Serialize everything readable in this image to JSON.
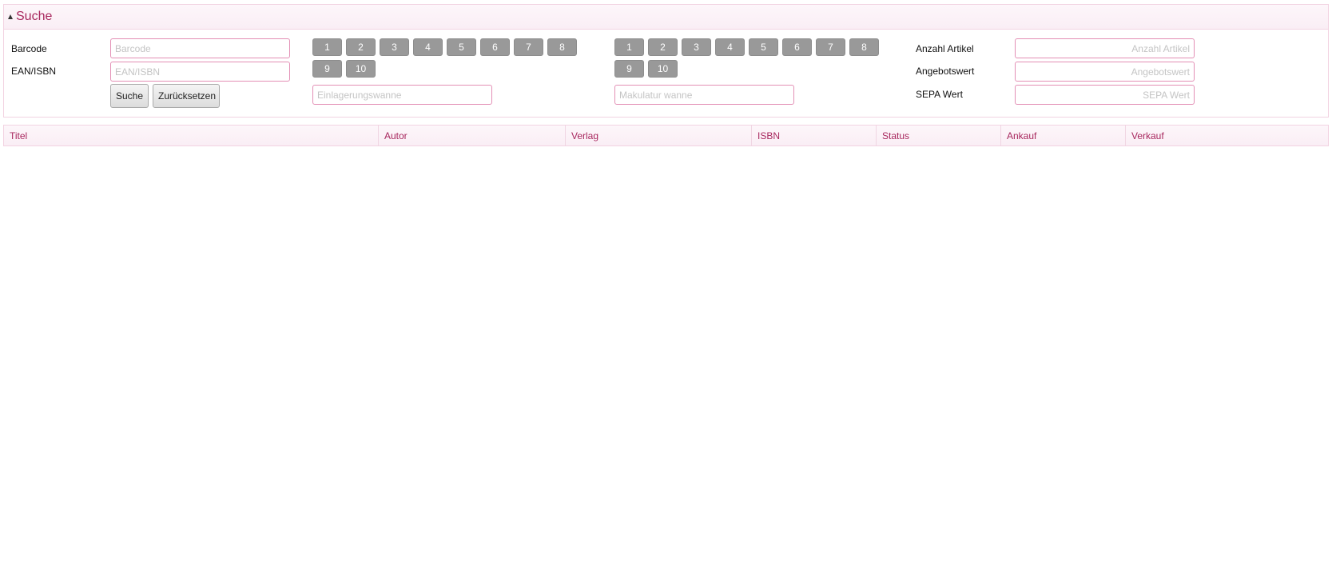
{
  "panel": {
    "title": "Suche"
  },
  "form": {
    "barcode_label": "Barcode",
    "barcode_placeholder": "Barcode",
    "ean_label": "EAN/ISBN",
    "ean_placeholder": "EAN/ISBN",
    "search_button": "Suche",
    "reset_button": "Zurücksetzen",
    "storage_placeholder": "Einlagerungswanne",
    "waste_placeholder": "Makulatur wanne"
  },
  "number_groups": {
    "storage": [
      "1",
      "2",
      "3",
      "4",
      "5",
      "6",
      "7",
      "8",
      "9",
      "10"
    ],
    "waste": [
      "1",
      "2",
      "3",
      "4",
      "5",
      "6",
      "7",
      "8",
      "9",
      "10"
    ]
  },
  "summary": {
    "article_count_label": "Anzahl Artikel",
    "article_count_placeholder": "Anzahl Artikel",
    "offer_value_label": "Angebotswert",
    "offer_value_placeholder": "Angebotswert",
    "sepa_label": "SEPA Wert",
    "sepa_placeholder": "SEPA Wert"
  },
  "table": {
    "columns": [
      "Titel",
      "Autor",
      "Verlag",
      "ISBN",
      "Status",
      "Ankauf",
      "Verkauf"
    ]
  },
  "colors": {
    "accent": "#a8285e",
    "input_border": "#e38fb5",
    "number_button": "#999999"
  }
}
